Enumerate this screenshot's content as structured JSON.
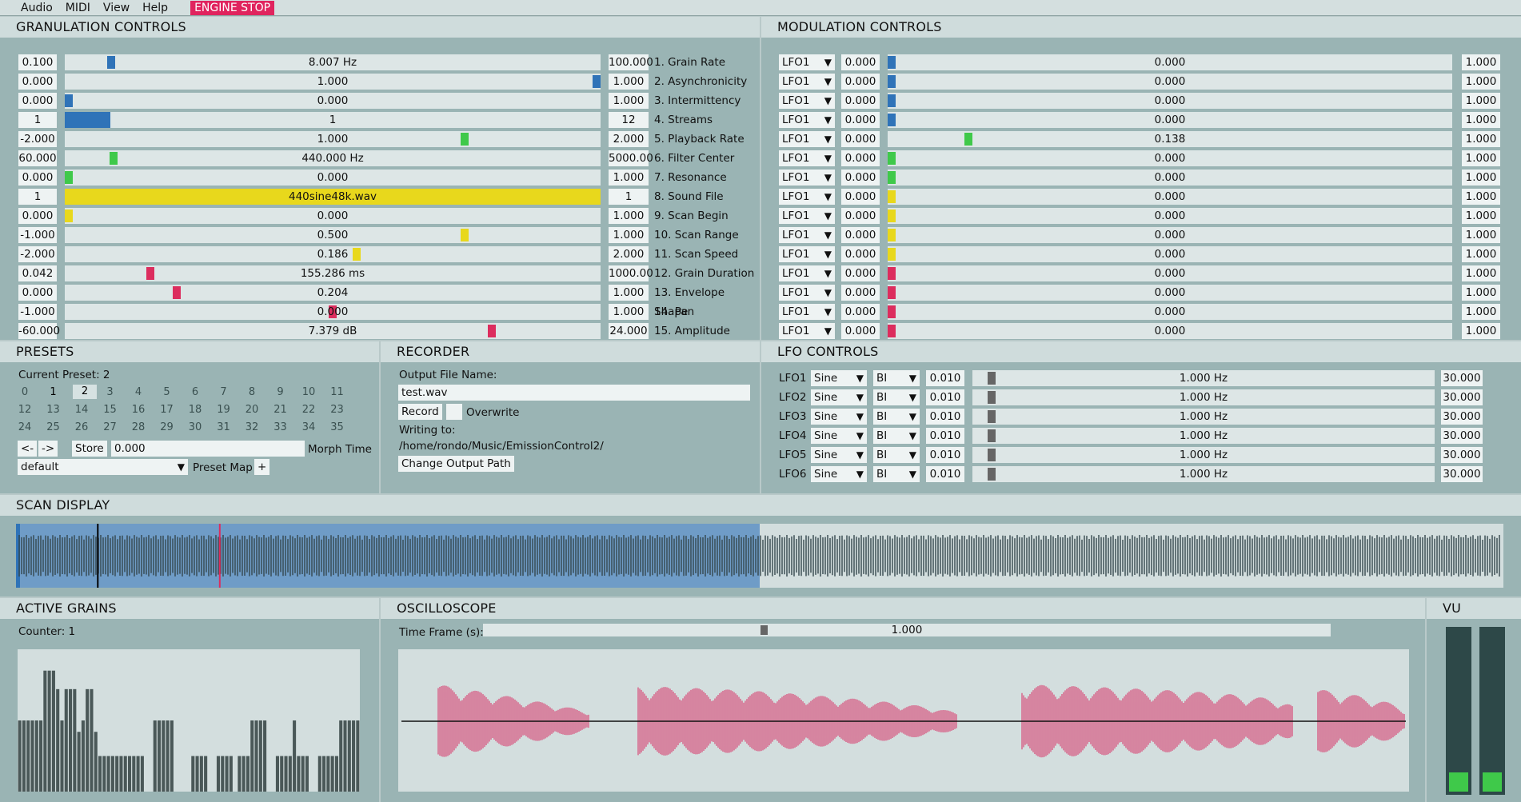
{
  "menu": {
    "items": [
      "Audio",
      "MIDI",
      "View",
      "Help"
    ],
    "engine_label": "ENGINE STOP",
    "engine_color": "#e0245e"
  },
  "granulation": {
    "title": "GRANULATION CONTROLS",
    "rows": [
      {
        "min": "0.100",
        "value": "8.007 Hz",
        "max": "100.000",
        "label": "1. Grain Rate",
        "level": 0.08,
        "color": "#2f73b8",
        "mode": "handle"
      },
      {
        "min": "0.000",
        "value": "1.000",
        "max": "1.000",
        "label": "2. Asynchronicity",
        "level": 1.0,
        "color": "#2f73b8",
        "mode": "handle"
      },
      {
        "min": "0.000",
        "value": "0.000",
        "max": "1.000",
        "label": "3. Intermittency",
        "level": 0.0,
        "color": "#2f73b8",
        "mode": "handle"
      },
      {
        "min": "1",
        "value": "1",
        "max": "12",
        "label": "4. Streams",
        "level": 0.085,
        "color": "#2f73b8",
        "mode": "fill"
      },
      {
        "min": "-2.000",
        "value": "1.000",
        "max": "2.000",
        "label": "5. Playback Rate",
        "level": 0.75,
        "color": "#3fc94a",
        "mode": "handle"
      },
      {
        "min": "60.000",
        "value": "440.000 Hz",
        "max": "5000.00",
        "label": "6. Filter Center",
        "level": 0.085,
        "color": "#3fc94a",
        "mode": "handle"
      },
      {
        "min": "0.000",
        "value": "0.000",
        "max": "1.000",
        "label": "7. Resonance",
        "level": 0.0,
        "color": "#3fc94a",
        "mode": "handle"
      },
      {
        "min": "1",
        "value": "440sine48k.wav",
        "max": "1",
        "label": "8. Sound File",
        "level": 1.0,
        "color": "#e8d81c",
        "mode": "fill"
      },
      {
        "min": "0.000",
        "value": "0.000",
        "max": "1.000",
        "label": "9. Scan Begin",
        "level": 0.0,
        "color": "#e8d81c",
        "mode": "handle"
      },
      {
        "min": "-1.000",
        "value": "0.500",
        "max": "1.000",
        "label": "10. Scan Range",
        "level": 0.75,
        "color": "#e8d81c",
        "mode": "handle"
      },
      {
        "min": "-2.000",
        "value": "0.186",
        "max": "2.000",
        "label": "11. Scan Speed",
        "level": 0.546,
        "color": "#e8d81c",
        "mode": "handle"
      },
      {
        "min": "0.042",
        "value": "155.286 ms",
        "max": "1000.00",
        "label": "12. Grain Duration",
        "level": 0.155,
        "color": "#dc2d5e",
        "mode": "handle"
      },
      {
        "min": "0.000",
        "value": "0.204",
        "max": "1.000",
        "label": "13. Envelope Shape",
        "level": 0.204,
        "color": "#dc2d5e",
        "mode": "handle"
      },
      {
        "min": "-1.000",
        "value": "0.000",
        "max": "1.000",
        "label": "14. Pan",
        "level": 0.5,
        "color": "#dc2d5e",
        "mode": "handle"
      },
      {
        "min": "-60.000",
        "value": "7.379 dB",
        "max": "24.000",
        "label": "15. Amplitude",
        "level": 0.802,
        "color": "#dc2d5e",
        "mode": "handle"
      }
    ]
  },
  "modulation": {
    "title": "MODULATION CONTROLS",
    "rows": [
      {
        "src": "LFO1",
        "min": "0.000",
        "value": "0.000",
        "max": "1.000",
        "level": 0.0,
        "color": "#2f73b8"
      },
      {
        "src": "LFO1",
        "min": "0.000",
        "value": "0.000",
        "max": "1.000",
        "level": 0.0,
        "color": "#2f73b8"
      },
      {
        "src": "LFO1",
        "min": "0.000",
        "value": "0.000",
        "max": "1.000",
        "level": 0.0,
        "color": "#2f73b8"
      },
      {
        "src": "LFO1",
        "min": "0.000",
        "value": "0.000",
        "max": "1.000",
        "level": 0.0,
        "color": "#2f73b8"
      },
      {
        "src": "LFO1",
        "min": "0.000",
        "value": "0.138",
        "max": "1.000",
        "level": 0.138,
        "color": "#3fc94a"
      },
      {
        "src": "LFO1",
        "min": "0.000",
        "value": "0.000",
        "max": "1.000",
        "level": 0.0,
        "color": "#3fc94a"
      },
      {
        "src": "LFO1",
        "min": "0.000",
        "value": "0.000",
        "max": "1.000",
        "level": 0.0,
        "color": "#3fc94a"
      },
      {
        "src": "LFO1",
        "min": "0.000",
        "value": "0.000",
        "max": "1.000",
        "level": 0.0,
        "color": "#e8d81c"
      },
      {
        "src": "LFO1",
        "min": "0.000",
        "value": "0.000",
        "max": "1.000",
        "level": 0.0,
        "color": "#e8d81c"
      },
      {
        "src": "LFO1",
        "min": "0.000",
        "value": "0.000",
        "max": "1.000",
        "level": 0.0,
        "color": "#e8d81c"
      },
      {
        "src": "LFO1",
        "min": "0.000",
        "value": "0.000",
        "max": "1.000",
        "level": 0.0,
        "color": "#e8d81c"
      },
      {
        "src": "LFO1",
        "min": "0.000",
        "value": "0.000",
        "max": "1.000",
        "level": 0.0,
        "color": "#dc2d5e"
      },
      {
        "src": "LFO1",
        "min": "0.000",
        "value": "0.000",
        "max": "1.000",
        "level": 0.0,
        "color": "#dc2d5e"
      },
      {
        "src": "LFO1",
        "min": "0.000",
        "value": "0.000",
        "max": "1.000",
        "level": 0.0,
        "color": "#dc2d5e"
      },
      {
        "src": "LFO1",
        "min": "0.000",
        "value": "0.000",
        "max": "1.000",
        "level": 0.0,
        "color": "#dc2d5e"
      }
    ]
  },
  "presets": {
    "title": "PRESETS",
    "current": "Current Preset: 2",
    "numbers": [
      "0",
      "1",
      "2",
      "3",
      "4",
      "5",
      "6",
      "7",
      "8",
      "9",
      "10",
      "11",
      "12",
      "13",
      "14",
      "15",
      "16",
      "17",
      "18",
      "19",
      "20",
      "21",
      "22",
      "23",
      "24",
      "25",
      "26",
      "27",
      "28",
      "29",
      "30",
      "31",
      "32",
      "33",
      "34",
      "35"
    ],
    "active": [
      "1",
      "2"
    ],
    "selected": "2",
    "prev_label": "<-",
    "next_label": "->",
    "store_label": "Store",
    "morph_value": "0.000",
    "morph_label": "Morph Time",
    "map_value": "default",
    "map_label": "Preset Map",
    "add_label": "+"
  },
  "recorder": {
    "title": "RECORDER",
    "output_label": "Output File Name:",
    "output_value": "test.wav",
    "record_label": "Record",
    "overwrite_label": "Overwrite",
    "writing_label": "Writing to:",
    "path": "/home/rondo/Music/EmissionControl2/",
    "change_label": "Change Output Path"
  },
  "lfo": {
    "title": "LFO CONTROLS",
    "rows": [
      {
        "name": "LFO1",
        "shape": "Sine",
        "polarity": "BI",
        "min": "0.010",
        "value": "1.000 Hz",
        "max": "30.000",
        "level": 0.033
      },
      {
        "name": "LFO2",
        "shape": "Sine",
        "polarity": "BI",
        "min": "0.010",
        "value": "1.000 Hz",
        "max": "30.000",
        "level": 0.033
      },
      {
        "name": "LFO3",
        "shape": "Sine",
        "polarity": "BI",
        "min": "0.010",
        "value": "1.000 Hz",
        "max": "30.000",
        "level": 0.033
      },
      {
        "name": "LFO4",
        "shape": "Sine",
        "polarity": "BI",
        "min": "0.010",
        "value": "1.000 Hz",
        "max": "30.000",
        "level": 0.033
      },
      {
        "name": "LFO5",
        "shape": "Sine",
        "polarity": "BI",
        "min": "0.010",
        "value": "1.000 Hz",
        "max": "30.000",
        "level": 0.033
      },
      {
        "name": "LFO6",
        "shape": "Sine",
        "polarity": "BI",
        "min": "0.010",
        "value": "1.000 Hz",
        "max": "30.000",
        "level": 0.033
      }
    ]
  },
  "scan": {
    "title": "SCAN DISPLAY",
    "range_start": 0.0,
    "range_end": 0.5,
    "playhead": 0.055,
    "scan_position": 0.137,
    "range_color": "#6f9cc7"
  },
  "active_grains": {
    "title": "ACTIVE GRAINS",
    "counter": "Counter: 1"
  },
  "oscilloscope": {
    "title": "OSCILLOSCOPE",
    "timeframe_label": "Time Frame (s):",
    "timeframe_value": "1.000",
    "timeframe_level": 0.33,
    "wave_color": "#d83a6c"
  },
  "vu": {
    "title": "VU",
    "left_level": 0.12,
    "right_level": 0.12,
    "meter_color": "#3fc94a"
  }
}
